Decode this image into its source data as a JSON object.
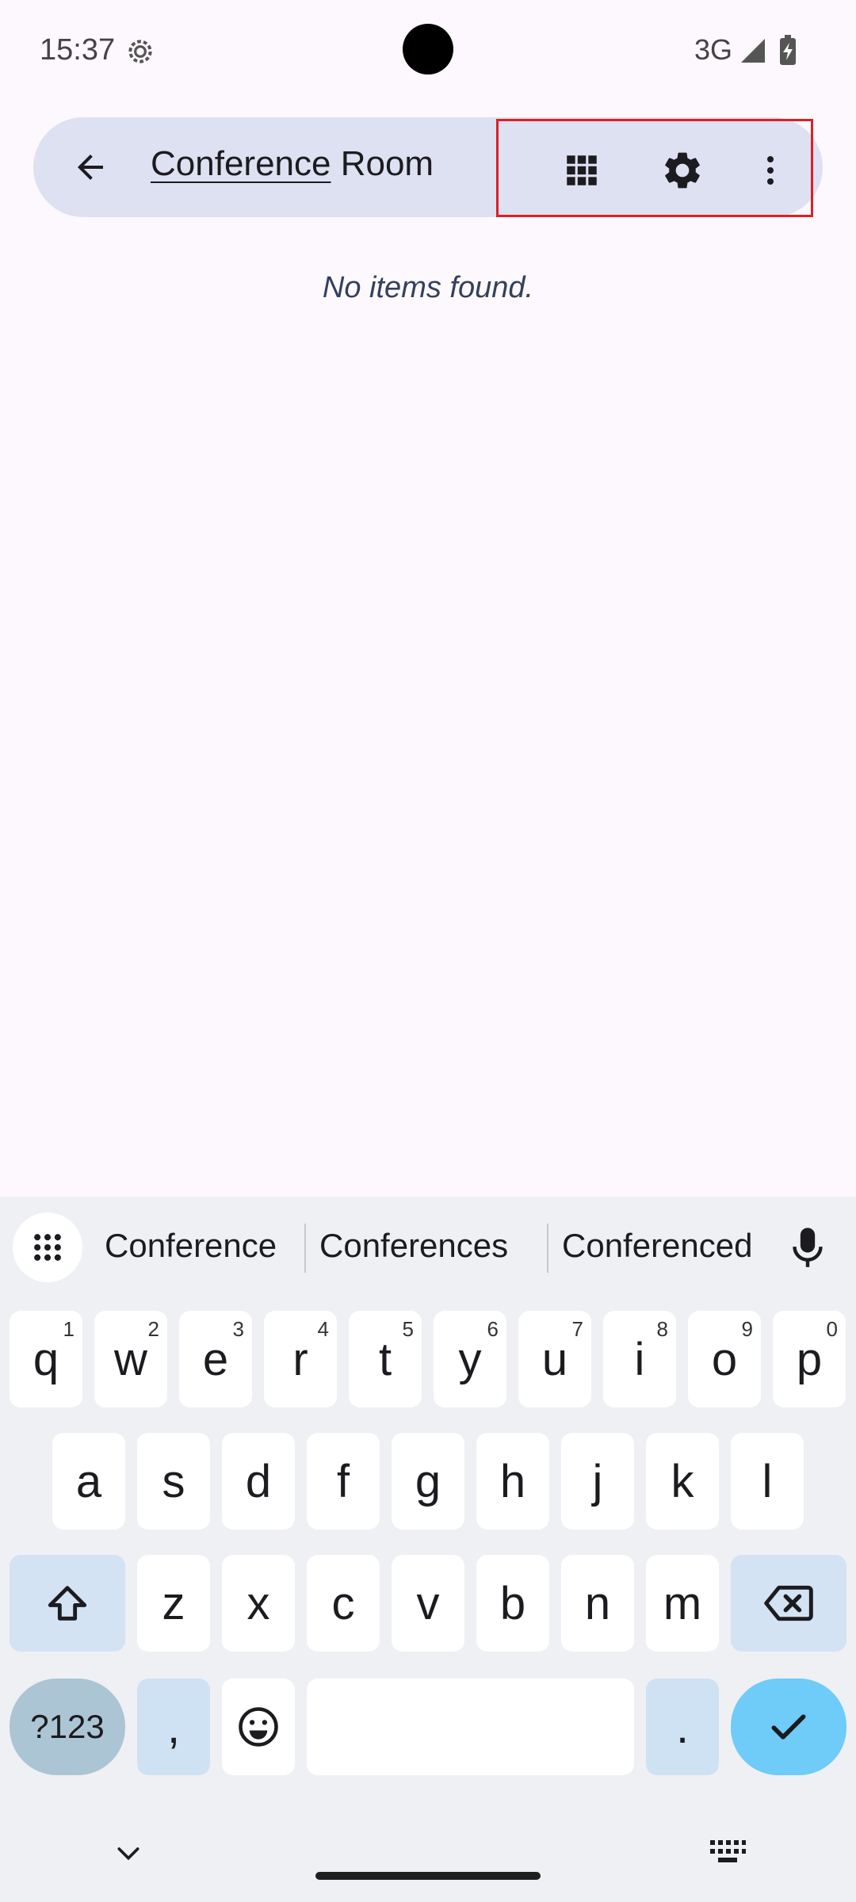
{
  "status_bar": {
    "time": "15:37",
    "network": "3G"
  },
  "search": {
    "query_underlined": "Conference",
    "query_rest": " Room",
    "empty_message": "No items found."
  },
  "keyboard": {
    "suggestions": [
      "Conference",
      "Conferences",
      "Conferenced"
    ],
    "row1": [
      {
        "k": "q",
        "n": "1"
      },
      {
        "k": "w",
        "n": "2"
      },
      {
        "k": "e",
        "n": "3"
      },
      {
        "k": "r",
        "n": "4"
      },
      {
        "k": "t",
        "n": "5"
      },
      {
        "k": "y",
        "n": "6"
      },
      {
        "k": "u",
        "n": "7"
      },
      {
        "k": "i",
        "n": "8"
      },
      {
        "k": "o",
        "n": "9"
      },
      {
        "k": "p",
        "n": "0"
      }
    ],
    "row2": [
      "a",
      "s",
      "d",
      "f",
      "g",
      "h",
      "j",
      "k",
      "l"
    ],
    "row3": [
      "z",
      "x",
      "c",
      "v",
      "b",
      "n",
      "m"
    ],
    "symbols_label": "?123",
    "comma": ",",
    "period": "."
  },
  "colors": {
    "search_bg": "#dde1f2",
    "highlight_border": "#e01e25",
    "enter_key": "#6fcbf7"
  }
}
